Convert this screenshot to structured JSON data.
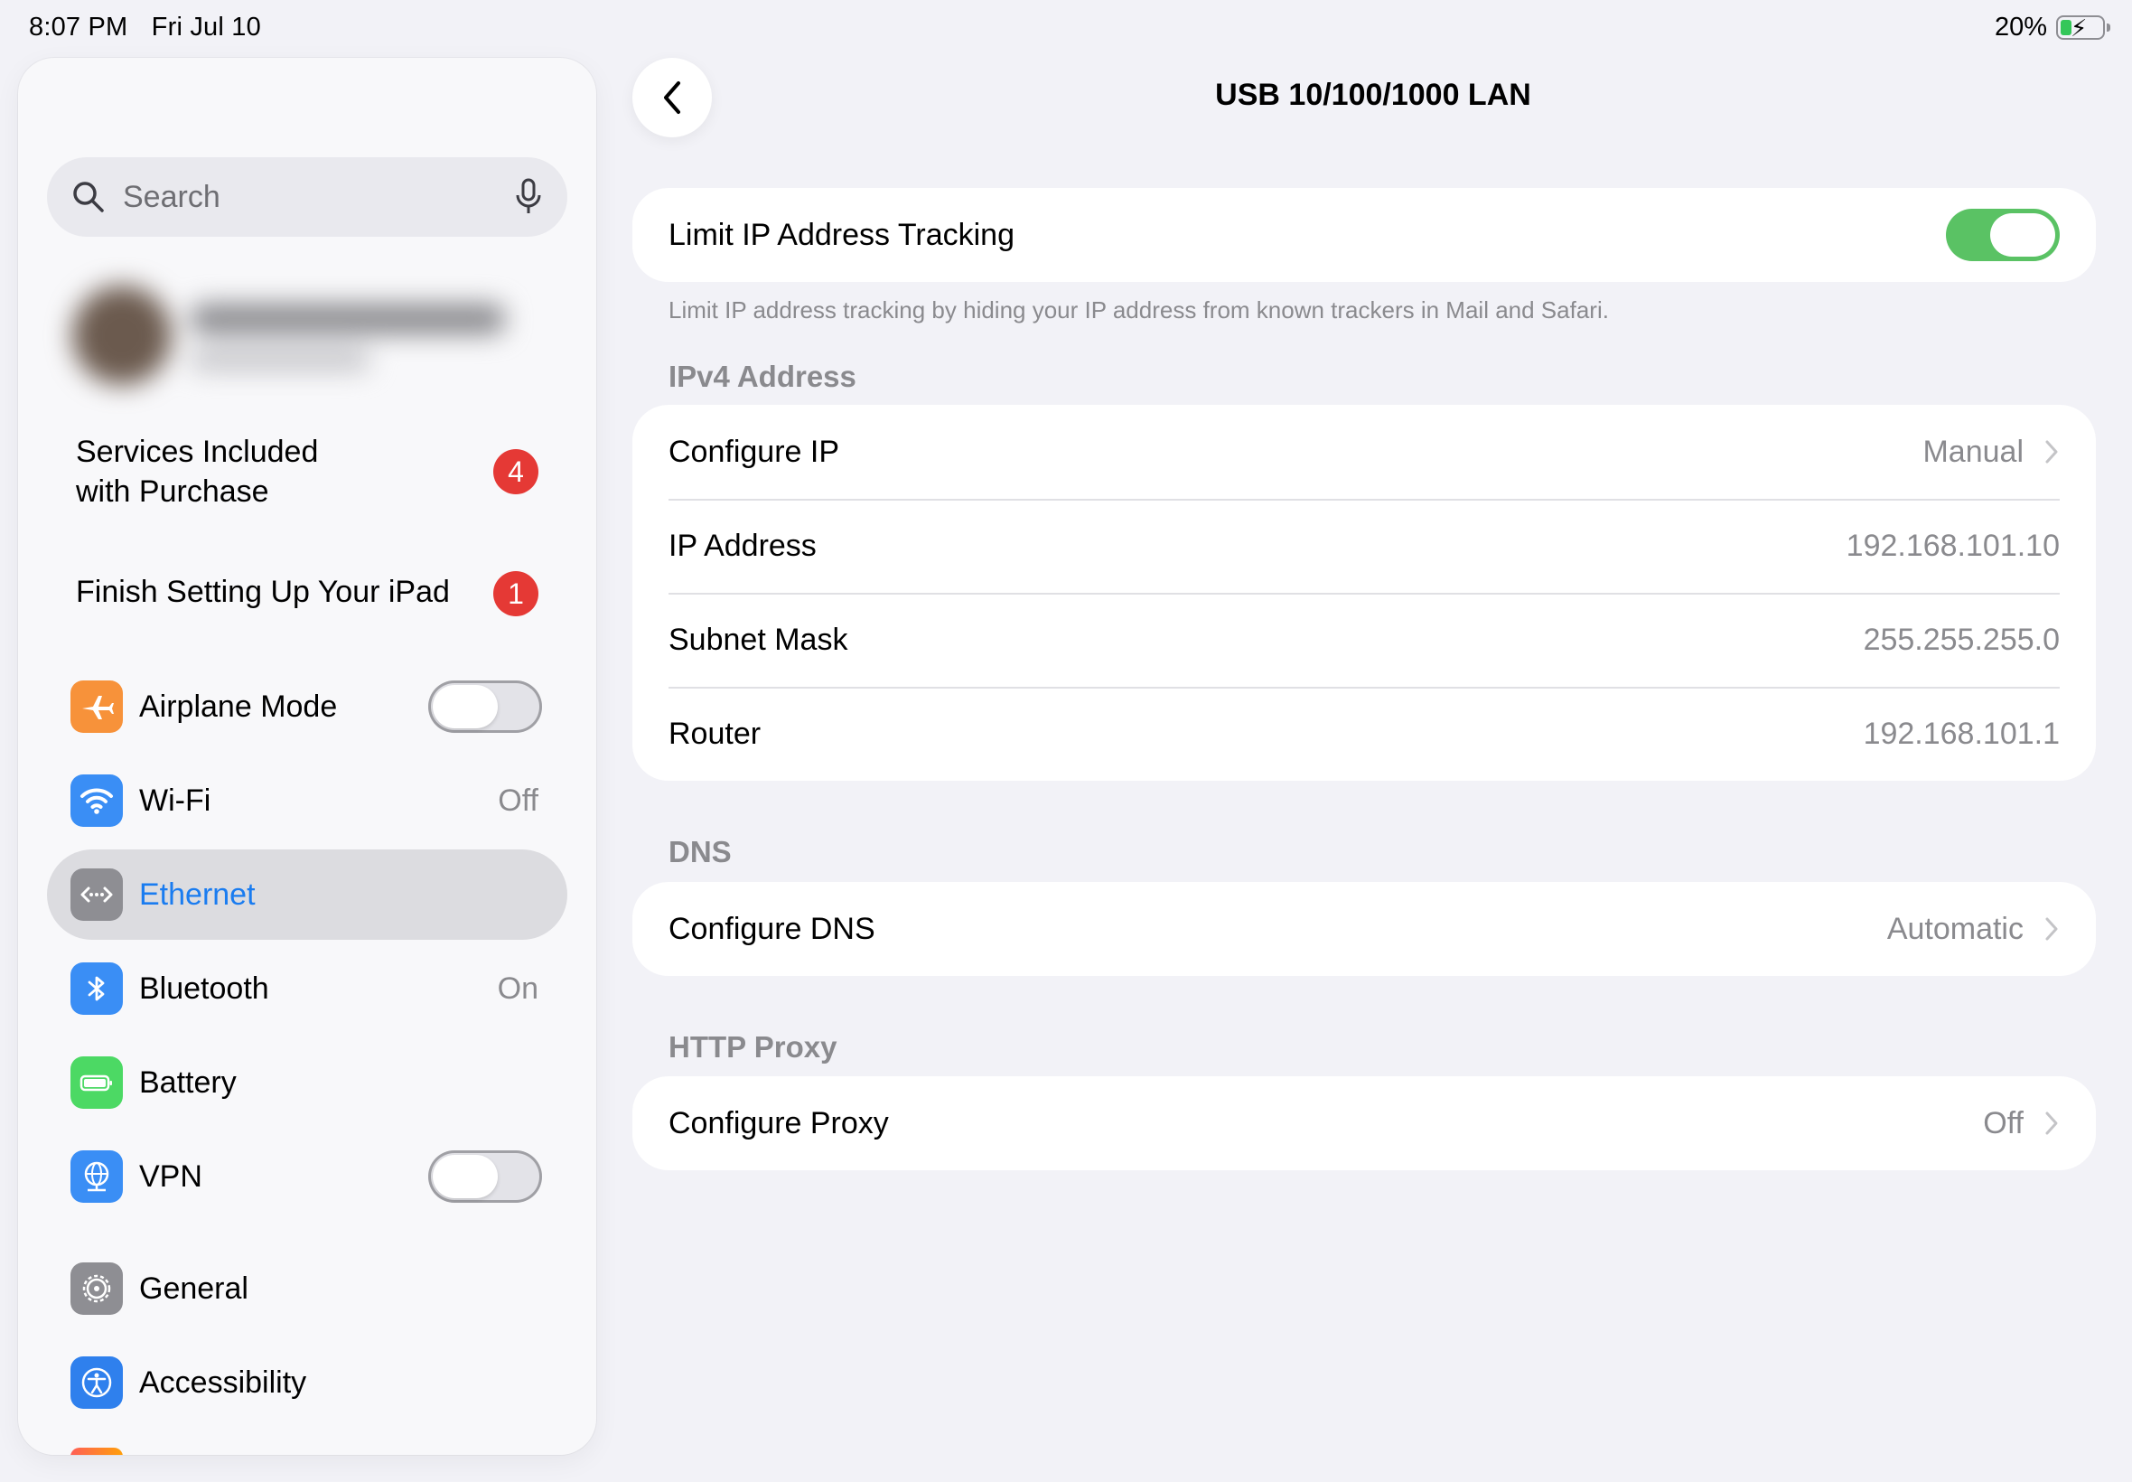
{
  "status": {
    "time": "8:07 PM",
    "date": "Fri Jul 10",
    "battery_pct": "20%",
    "battery_level": 0.2
  },
  "sidebar": {
    "search_placeholder": "Search",
    "services": {
      "label_line1": "Services Included",
      "label_line2": "with Purchase",
      "badge": "4"
    },
    "finish": {
      "label": "Finish Setting Up Your iPad",
      "badge": "1"
    },
    "items": [
      {
        "label": "Airplane Mode",
        "value": "",
        "color": "#f7923a"
      },
      {
        "label": "Wi-Fi",
        "value": "Off",
        "color": "#3a8ef5"
      },
      {
        "label": "Ethernet",
        "value": "",
        "color": "#8e8e93"
      },
      {
        "label": "Bluetooth",
        "value": "On",
        "color": "#3a8ef5"
      },
      {
        "label": "Battery",
        "value": "",
        "color": "#4cd964"
      },
      {
        "label": "VPN",
        "value": "",
        "color": "#3a8ef5"
      },
      {
        "label": "General",
        "value": "",
        "color": "#8e8e93"
      },
      {
        "label": "Accessibility",
        "value": "",
        "color": "#2f80ed"
      }
    ]
  },
  "main": {
    "title": "USB 10/100/1000 LAN",
    "limit_tracking": {
      "label": "Limit IP Address Tracking",
      "footnote": "Limit IP address tracking by hiding your IP address from known trackers in Mail and Safari."
    },
    "ipv4": {
      "header": "IPv4 Address",
      "rows": [
        {
          "label": "Configure IP",
          "value": "Manual"
        },
        {
          "label": "IP Address",
          "value": "192.168.101.10"
        },
        {
          "label": "Subnet Mask",
          "value": "255.255.255.0"
        },
        {
          "label": "Router",
          "value": "192.168.101.1"
        }
      ]
    },
    "dns": {
      "header": "DNS",
      "label": "Configure DNS",
      "value": "Automatic"
    },
    "proxy": {
      "header": "HTTP Proxy",
      "label": "Configure Proxy",
      "value": "Off"
    }
  }
}
